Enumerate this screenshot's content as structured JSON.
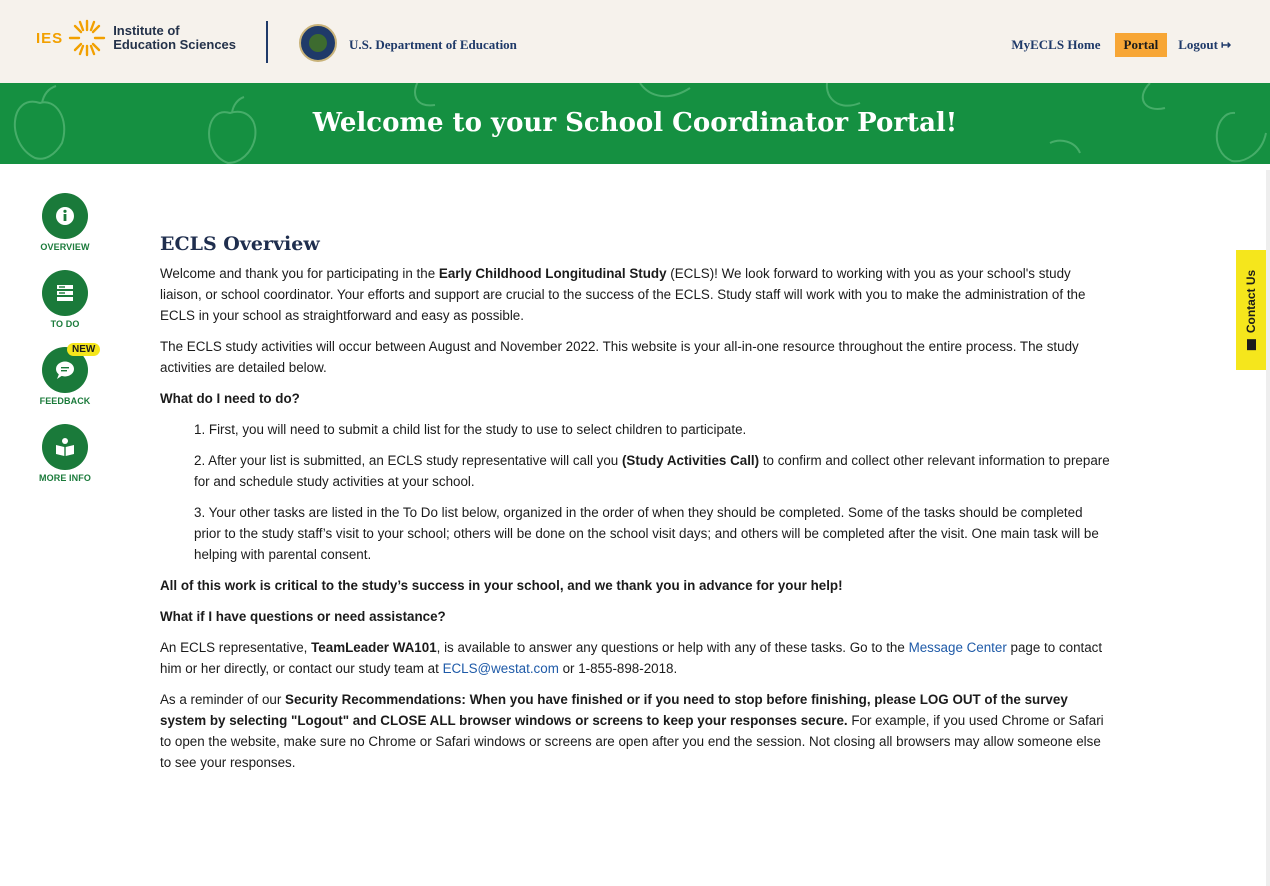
{
  "header": {
    "ies_abbr": "IES",
    "ies_name_line1": "Institute of",
    "ies_name_line2": "Education Sciences",
    "doe_name": "U.S. Department of Education",
    "nav": {
      "home": "MyECLS Home",
      "portal": "Portal",
      "logout": "Logout"
    }
  },
  "banner": {
    "title": "Welcome to your School Coordinator Portal!"
  },
  "rail": {
    "overview": "OVERVIEW",
    "todo": "TO DO",
    "feedback": "FEEDBACK",
    "feedback_badge": "NEW",
    "moreinfo": "MORE INFO"
  },
  "contact_tab": "Contact Us",
  "overview": {
    "title": "ECLS Overview",
    "p1_a": "Welcome and thank you for participating in the ",
    "p1_b": "Early Childhood Longitudinal Study",
    "p1_c": " (ECLS)! We look forward to working with you as your school's study liaison, or school coordinator. Your efforts and support are crucial to the success of the ECLS. Study staff will work with you to make the administration of the ECLS in your school as straightforward and easy as possible.",
    "p2": "The ECLS study activities will occur between August and November 2022. This website is your all-in-one resource throughout the entire process. The study activities are detailed below.",
    "q1": "What do I need to do?",
    "step1": "1. First, you will need to submit a child list for the study to use to select children to participate.",
    "step2_a": "2. After your list is submitted, an ECLS study representative will call you ",
    "step2_b": "(Study Activities Call)",
    "step2_c": " to confirm and collect other relevant information to prepare for and schedule study activities at your school.",
    "step3": "3. Your other tasks are listed in the To Do list below, organized in the order of when they should be completed. Some of the tasks should be completed prior to the study staff’s visit to your school; others will be done on the school visit days; and others will be completed after the visit. One main task will be helping with parental consent.",
    "critical": "All of this work is critical to the study’s success in your school, and we thank you in advance for your help!",
    "q2": "What if I have questions or need assistance?",
    "p3_a": "An ECLS representative, ",
    "p3_b": "TeamLeader WA101",
    "p3_c": ", is available to answer any questions or help with any of these tasks. Go to the ",
    "p3_link1": "Message Center",
    "p3_d": " page to contact him or her directly, or contact our study team at ",
    "p3_email": "ECLS@westat.com",
    "p3_e": " or 1-855-898-2018.",
    "p4_a": "As a reminder of our ",
    "p4_b": "Security Recommendations: When you have finished or if you need to stop before finishing, please LOG OUT of the survey system by selecting \"Logout\" and CLOSE ALL browser windows or screens to keep your responses secure.",
    "p4_c": " For example, if you used Chrome or Safari to open the website, make sure no Chrome or Safari windows or screens are open after you end the session. Not closing all browsers may allow someone else to see your responses."
  },
  "colors": {
    "banner_green": "#159041",
    "rail_green": "#1a7a3a",
    "portal_orange": "#f7a635",
    "contact_yellow": "#f5e61c",
    "link_blue": "#1e5aa8",
    "header_bg": "#f6f2ec"
  }
}
